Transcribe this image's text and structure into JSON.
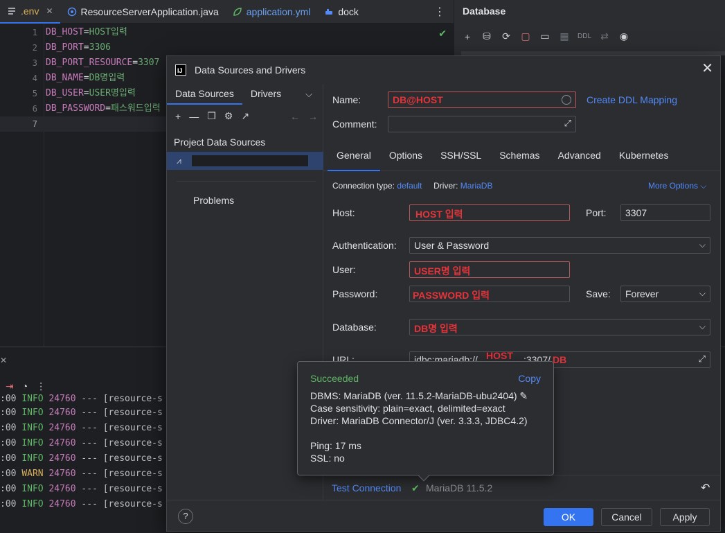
{
  "editor_tabs": [
    {
      "label": ".env",
      "active": true,
      "closable": true
    },
    {
      "label": "ResourceServerApplication.java"
    },
    {
      "label": "application.yml"
    },
    {
      "label": "dock"
    }
  ],
  "env_lines": [
    {
      "num": "1",
      "key": "DB_HOST",
      "val": "HOST입력"
    },
    {
      "num": "2",
      "key": "DB_PORT",
      "val": "3306"
    },
    {
      "num": "3",
      "key": "DB_PORT_RESOURCE",
      "val": "3307"
    },
    {
      "num": "4",
      "key": "DB_NAME",
      "val": "DB명입력"
    },
    {
      "num": "5",
      "key": "DB_USER",
      "val": "USER명입력"
    },
    {
      "num": "6",
      "key": "DB_PASSWORD",
      "val": "패스워드입력"
    },
    {
      "num": "7",
      "key": "",
      "val": ""
    }
  ],
  "database_panel": {
    "title": "Database",
    "ddl_label": "DDL"
  },
  "console": {
    "lines": [
      {
        "prefix": ":00",
        "level": "INFO",
        "pid": "24760",
        "rest": "--- [resource-s"
      },
      {
        "prefix": ":00",
        "level": "INFO",
        "pid": "24760",
        "rest": "--- [resource-s"
      },
      {
        "prefix": ":00",
        "level": "INFO",
        "pid": "24760",
        "rest": "--- [resource-s"
      },
      {
        "prefix": ":00",
        "level": "INFO",
        "pid": "24760",
        "rest": "--- [resource-s"
      },
      {
        "prefix": ":00",
        "level": "INFO",
        "pid": "24760",
        "rest": "--- [resource-s"
      },
      {
        "prefix": ":00",
        "level": "WARN",
        "pid": "24760",
        "rest": "--- [resource-s"
      },
      {
        "prefix": ":00",
        "level": "INFO",
        "pid": "24760",
        "rest": "--- [resource-s"
      },
      {
        "prefix": ":00",
        "level": "INFO",
        "pid": "24760",
        "rest": "--- [resource-s"
      }
    ]
  },
  "dialog": {
    "title": "Data Sources and Drivers",
    "left_tabs": [
      "Data Sources",
      "Drivers"
    ],
    "group_title": "Project Data Sources",
    "problems": "Problems",
    "name_label": "Name:",
    "name_value": "DB@HOST",
    "create_ddl_link": "Create DDL Mapping",
    "comment_label": "Comment:",
    "tabs": [
      "General",
      "Options",
      "SSH/SSL",
      "Schemas",
      "Advanced",
      "Kubernetes"
    ],
    "connection_type_label": "Connection type:",
    "connection_type_value": "default",
    "driver_label": "Driver:",
    "driver_value": "MariaDB",
    "more_options": "More Options",
    "host_label": "Host:",
    "host_value": "HOST 입력",
    "port_label": "Port:",
    "port_value": "3307",
    "auth_label": "Authentication:",
    "auth_value": "User & Password",
    "user_label": "User:",
    "user_value": "USER명 입력",
    "password_label": "Password:",
    "password_value": "PASSWORD 입력",
    "save_label": "Save:",
    "save_value": "Forever",
    "database_label": "Database:",
    "database_value": "DB명 입력",
    "url_label": "URL:",
    "url_prefix": "jdbc:mariadb://",
    "url_host": "HOST",
    "url_port": ":3307/",
    "url_db": "DB",
    "test_connection": "Test Connection",
    "test_result": "MariaDB 11.5.2",
    "buttons": {
      "ok": "OK",
      "cancel": "Cancel",
      "apply": "Apply"
    }
  },
  "popup": {
    "status": "Succeeded",
    "copy": "Copy",
    "dbms": "DBMS: MariaDB (ver. 11.5.2-MariaDB-ubu2404)",
    "case": "Case sensitivity: plain=exact, delimited=exact",
    "driver": "Driver: MariaDB Connector/J (ver. 3.3.3, JDBC4.2)",
    "ping": "Ping: 17 ms",
    "ssl": "SSL: no"
  },
  "colors": {
    "accent": "#3574f0",
    "success": "#5fb865",
    "error_text": "#e5333a",
    "link": "#548af7"
  }
}
